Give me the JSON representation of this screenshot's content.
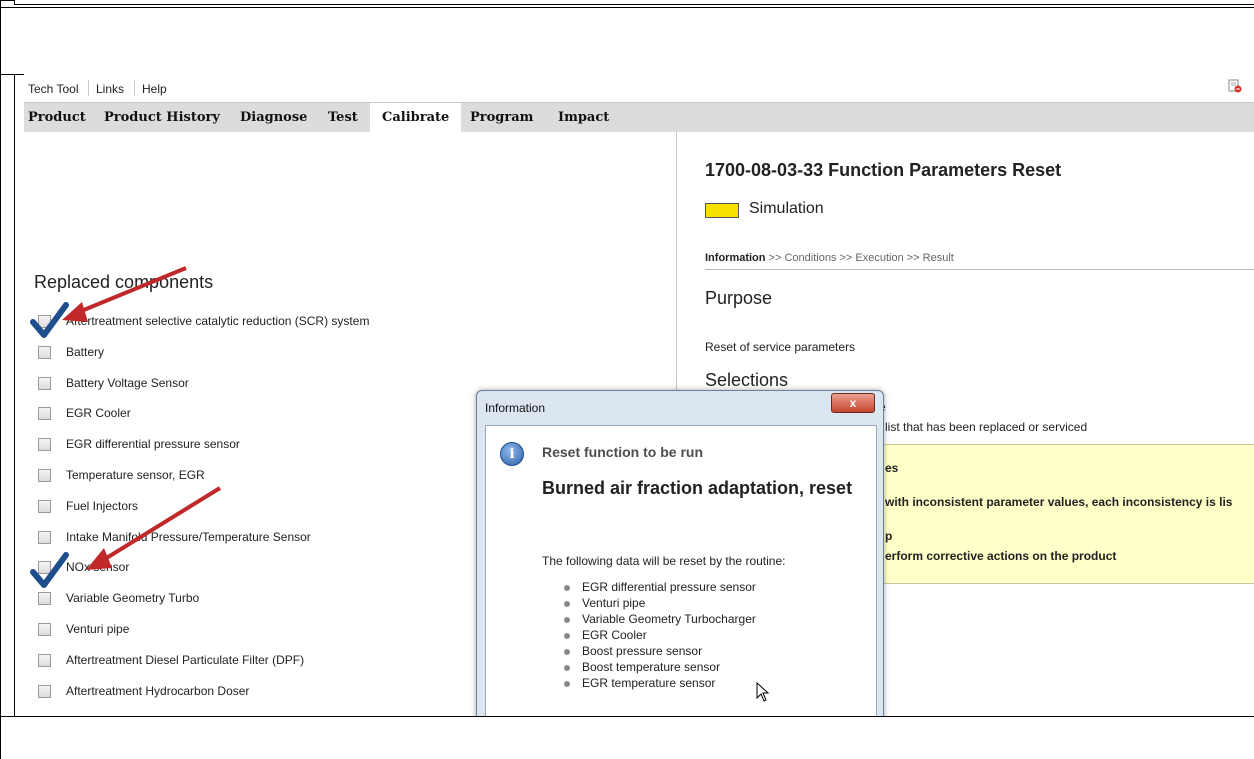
{
  "menubar": {
    "items": [
      "Tech Tool",
      "Links",
      "Help"
    ],
    "exit_icon": "exit-icon"
  },
  "nav": {
    "tabs": [
      "Product",
      "Product History",
      "Diagnose",
      "Test",
      "Calibrate",
      "Program",
      "Impact"
    ],
    "active": "Calibrate"
  },
  "left": {
    "title": "Replaced components",
    "components": [
      {
        "label": "Aftertreatment selective catalytic reduction (SCR) system",
        "checked": true
      },
      {
        "label": "Battery",
        "checked": false
      },
      {
        "label": "Battery Voltage Sensor",
        "checked": false
      },
      {
        "label": "EGR Cooler",
        "checked": false
      },
      {
        "label": "EGR differential pressure sensor",
        "checked": false
      },
      {
        "label": "Temperature sensor, EGR",
        "checked": false
      },
      {
        "label": "Fuel Injectors",
        "checked": false
      },
      {
        "label": "Intake Manifold Pressure/Temperature Sensor",
        "checked": false
      },
      {
        "label": "NOx sensor",
        "checked": true
      },
      {
        "label": "Variable Geometry Turbo",
        "checked": false
      },
      {
        "label": "Venturi pipe",
        "checked": false
      },
      {
        "label": "Aftertreatment Diesel Particulate Filter (DPF)",
        "checked": false
      },
      {
        "label": "Aftertreatment Hydrocarbon Doser",
        "checked": false
      }
    ],
    "annotation_color": "#c0282a",
    "check_color": "#1f4e8c"
  },
  "right": {
    "title": "1700-08-03-33 Function Parameters Reset",
    "simulation_label": "Simulation",
    "simulation_color": "#f5e000",
    "steps": {
      "current": "Information",
      "rest": " >> Conditions >> Execution >> Result"
    },
    "purpose_heading": "Purpose",
    "purpose_text": "Reset of service parameters",
    "selections_heading": "Selections",
    "selection_hint": "e",
    "selection_text": "list that has been replaced or serviced",
    "yellow_line1": "es",
    "yellow_line2": "with inconsistent parameter values, each inconsistency is lis",
    "yellow_line3": "p",
    "yellow_line4": "erform corrective actions on the product"
  },
  "dialog": {
    "title": "Information",
    "close_label": "x",
    "heading": "Reset function to be run",
    "main": "Burned air fraction adaptation, reset",
    "intro": "The following data will be reset by the routine:",
    "items": [
      "EGR differential pressure sensor",
      "Venturi pipe",
      "Variable Geometry Turbocharger",
      "EGR Cooler",
      "Boost pressure sensor",
      "Boost temperature sensor",
      "EGR temperature sensor"
    ]
  }
}
